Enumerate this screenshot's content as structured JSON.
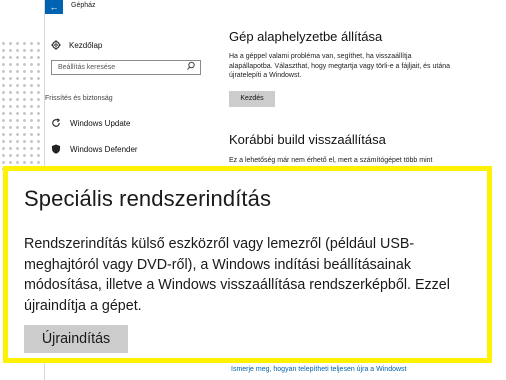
{
  "window": {
    "app_title": "Gépház",
    "back_label": "←"
  },
  "sidebar": {
    "home_label": "Kezdőlap",
    "search_placeholder": "Beállítás keresése",
    "section_header": "Frissítés és biztonság",
    "items": [
      {
        "label": "Windows Update",
        "icon": "refresh-icon"
      },
      {
        "label": "Windows Defender",
        "icon": "shield-icon"
      }
    ]
  },
  "reset": {
    "heading": "Gép alaphelyzetbe állítása",
    "description": "Ha a géppel valami probléma van, segíthet, ha visszaállítja alapállapotba. Választhat, hogy megtartja vagy törli-e a fájljait, és utána újratelepíti a Windowst.",
    "button_label": "Kezdés"
  },
  "previous_build": {
    "heading": "Korábbi build visszaállítása",
    "description": "Ez a lehetőség már nem érhető el, mert a számítógépet több mint"
  },
  "advanced_startup": {
    "heading": "Speciális rendszerindítás",
    "description": "Rendszerindítás külső eszközről vagy lemezről (például USB-meghajtóról vagy DVD-ről), a Windows indítási beállításainak módosítása, illetve a Windows visszaállítása rendszerképből. Ezzel újraindítja a gépet.",
    "button_label": "Újraindítás"
  },
  "footer_link": "Ismerje meg, hogyan telepítheti teljesen újra a Windowst",
  "colors": {
    "highlight_border": "#fff200",
    "accent": "#0063b1",
    "button_bg": "#cccccc"
  }
}
